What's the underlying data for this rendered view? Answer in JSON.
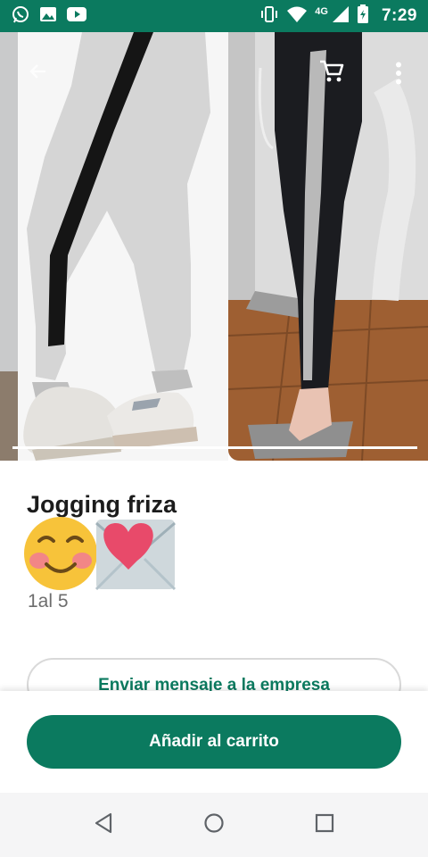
{
  "status_bar": {
    "time": "7:29",
    "network": "4G",
    "icons": [
      "whatsapp-icon",
      "gallery-icon",
      "youtube-icon",
      "vibrate-icon",
      "wifi-icon",
      "signal-icon",
      "battery-icon"
    ]
  },
  "gallery": {
    "icons": [
      "back-arrow-icon",
      "cart-icon",
      "more-vert-icon"
    ],
    "progress_fraction": 1.0
  },
  "product": {
    "title": "Jogging friza",
    "emojis": [
      "smiling-face-icon",
      "love-letter-icon"
    ],
    "description": "1al 5"
  },
  "actions": {
    "message_label": "Enviar mensaje a la empresa",
    "add_to_cart_label": "Añadir al carrito"
  },
  "nav": {
    "icons": [
      "back-icon",
      "home-icon",
      "recents-icon"
    ]
  },
  "colors": {
    "brand": "#0b7a5f",
    "title": "#1c1c1c",
    "secondary_text": "#6d6d6d",
    "nav_bar": "#f5f5f6"
  }
}
